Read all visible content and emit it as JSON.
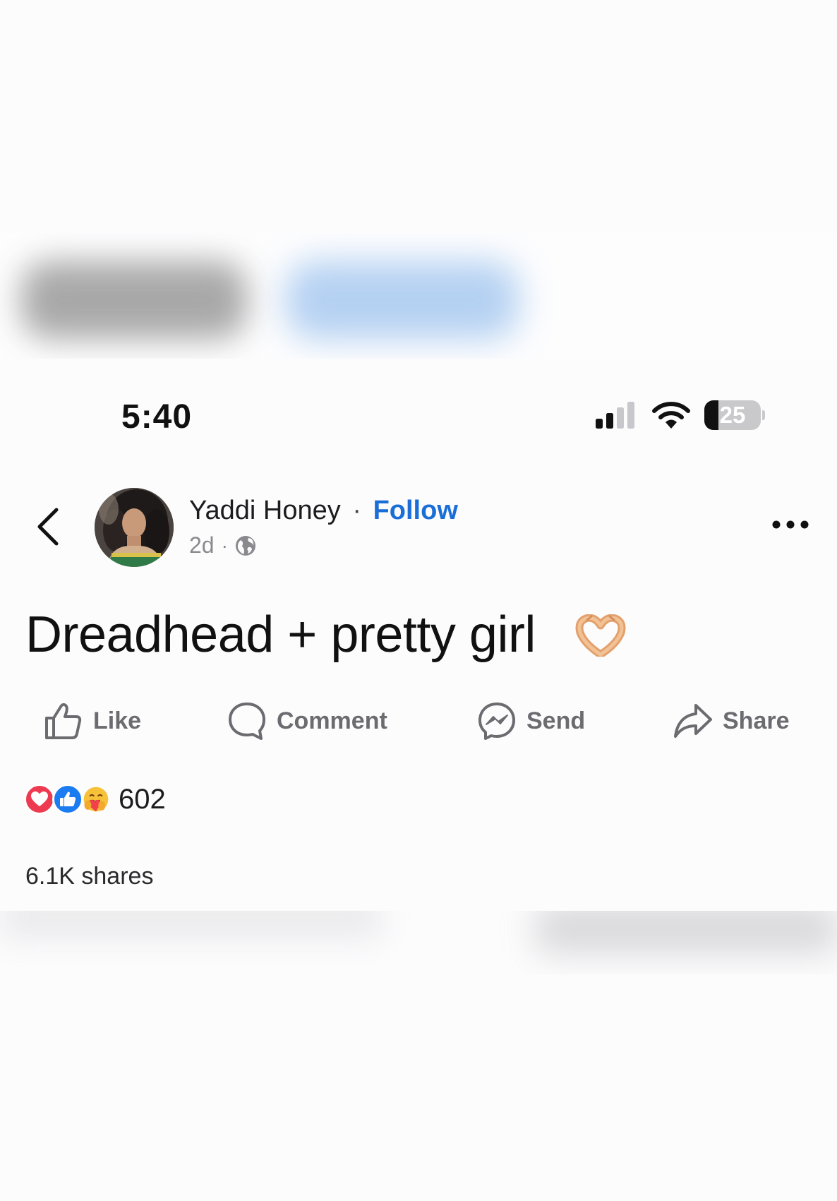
{
  "status_bar": {
    "time": "5:40",
    "battery_level": "25",
    "battery_fraction": 0.25
  },
  "post": {
    "author": "Yaddi Honey",
    "separator": "·",
    "follow_label": "Follow",
    "age": "2d",
    "meta_separator": "·",
    "privacy_icon": "globe-icon",
    "text": "Dreadhead + pretty girl",
    "text_emoji": "heart-hands"
  },
  "actions": {
    "like": "Like",
    "comment": "Comment",
    "send": "Send",
    "share": "Share"
  },
  "engagement": {
    "reaction_icons": [
      "love",
      "like",
      "care"
    ],
    "reaction_count": "602",
    "shares": "6.1K shares"
  },
  "colors": {
    "accent": "#1a6ed8",
    "love": "#ee3a50",
    "like": "#1b7cf2",
    "muted_text": "#6b6b70"
  }
}
